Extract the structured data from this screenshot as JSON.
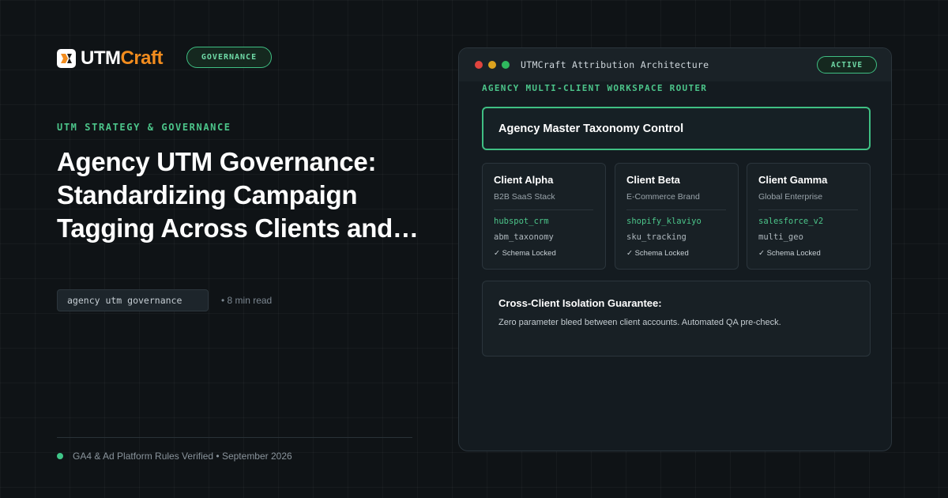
{
  "brand": {
    "name_part1": "UTM",
    "name_part2": "Craft",
    "badge": "GOVERNANCE"
  },
  "article": {
    "eyebrow": "UTM STRATEGY & GOVERNANCE",
    "headline": "Agency UTM Governance: Standardizing Campaign Tagging Across Clients and…",
    "tag": "agency utm governance",
    "read_time": "• 8 min read"
  },
  "footer": {
    "text": "GA4 & Ad Platform Rules Verified • September 2026"
  },
  "window": {
    "title": "UTMCraft Attribution Architecture",
    "status": "ACTIVE",
    "section_label": "AGENCY MULTI-CLIENT WORKSPACE ROUTER",
    "master": "Agency Master Taxonomy Control",
    "clients": [
      {
        "name": "Client Alpha",
        "subtitle": "B2B SaaS Stack",
        "param1": "hubspot_crm",
        "param2": "abm_taxonomy",
        "lock": "✓ Schema Locked"
      },
      {
        "name": "Client Beta",
        "subtitle": "E-Commerce Brand",
        "param1": "shopify_klaviyo",
        "param2": "sku_tracking",
        "lock": "✓ Schema Locked"
      },
      {
        "name": "Client Gamma",
        "subtitle": "Global Enterprise",
        "param1": "salesforce_v2",
        "param2": "multi_geo",
        "lock": "✓ Schema Locked"
      }
    ],
    "isolation": {
      "title": "Cross-Client Isolation Guarantee:",
      "text": "Zero parameter bleed between client accounts. Automated QA pre-check."
    }
  },
  "colors": {
    "accent_green": "#3fbf83",
    "brand_orange": "#f28c1e",
    "background": "#0f1316"
  },
  "icons": [
    "utmcraft-logo-icon",
    "window-close-dot",
    "window-minimize-dot",
    "window-maximize-dot",
    "status-dot"
  ]
}
